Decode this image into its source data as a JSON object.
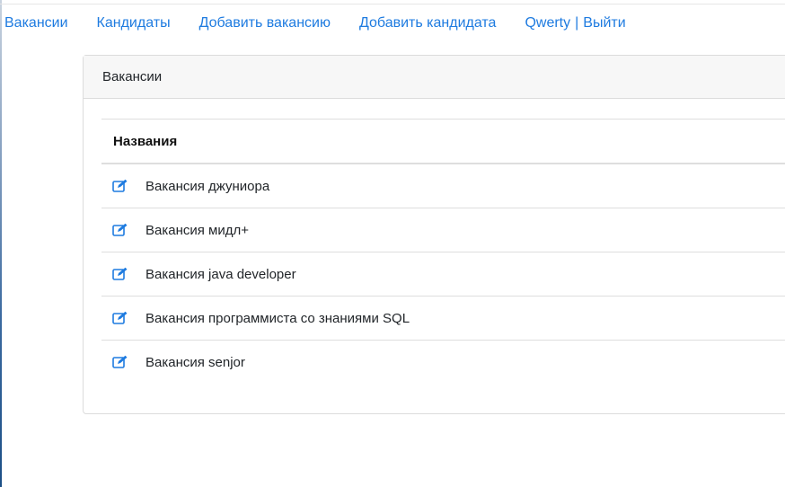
{
  "nav": {
    "items": [
      {
        "label": "Вакансии"
      },
      {
        "label": "Кандидаты"
      },
      {
        "label": "Добавить вакансию"
      },
      {
        "label": "Добавить кандидата"
      }
    ],
    "user": "Qwerty",
    "separator": "|",
    "logout": "Выйти"
  },
  "card": {
    "title": "Вакансии",
    "table": {
      "column_header": "Названия",
      "rows": [
        {
          "name": "Вакансия джуниора",
          "icon": "edit-icon"
        },
        {
          "name": "Вакансия мидл+",
          "icon": "edit-icon"
        },
        {
          "name": "Вакансия java developer",
          "icon": "edit-icon"
        },
        {
          "name": "Вакансия программиста со знаниями SQL",
          "icon": "edit-icon"
        },
        {
          "name": "Вакансия senjor",
          "icon": "edit-icon"
        }
      ]
    }
  },
  "colors": {
    "link": "#1e7be0",
    "border": "#dedede",
    "header_bg": "#f7f7f7"
  }
}
